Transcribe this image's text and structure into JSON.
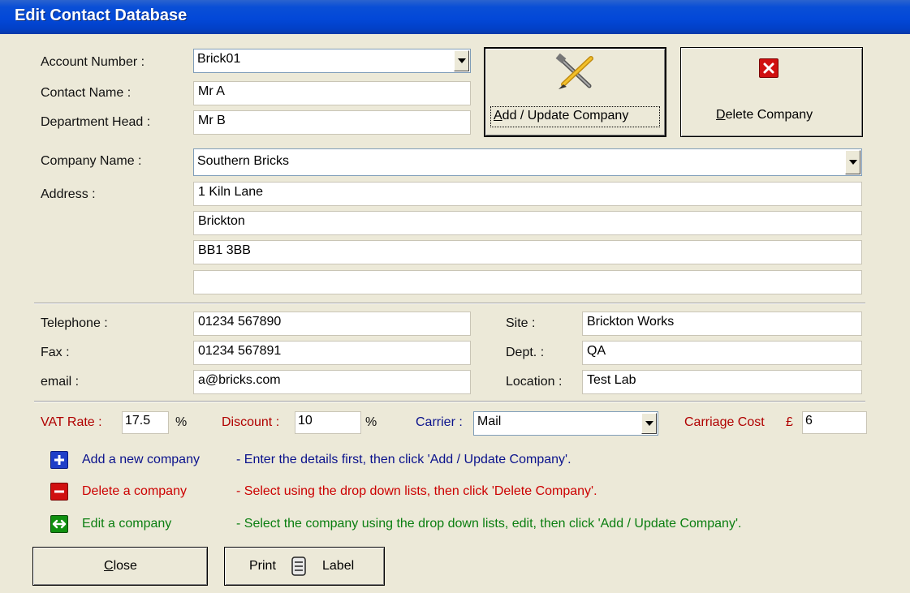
{
  "window": {
    "title": "Edit Contact Database"
  },
  "labels": {
    "account_number": "Account Number :",
    "contact_name": "Contact Name :",
    "department_head": "Department Head :",
    "company_name": "Company Name :",
    "address": "Address :",
    "telephone": "Telephone :",
    "fax": "Fax :",
    "email": "email :",
    "site": "Site :",
    "dept": "Dept. :",
    "location": "Location :",
    "vat_rate": "VAT Rate :",
    "vat_unit": "%",
    "discount": "Discount :",
    "discount_unit": "%",
    "carrier": "Carrier :",
    "carriage_cost": "Carriage Cost",
    "carriage_currency": "£"
  },
  "values": {
    "account_number": "Brick01",
    "contact_name": "Mr A",
    "department_head": "Mr B",
    "company_name": "Southern Bricks",
    "address_line1": "1 Kiln Lane",
    "address_line2": "Brickton",
    "address_line3": "BB1 3BB",
    "address_line4": "",
    "telephone": "01234 567890",
    "fax": "01234 567891",
    "email": "a@bricks.com",
    "site": "Brickton Works",
    "dept": "QA",
    "location": "Test Lab",
    "vat_rate": "17.5",
    "discount": "10",
    "carrier": "Mail",
    "carriage_cost": "6"
  },
  "buttons": {
    "add_update_pre": "",
    "add_update_key": "A",
    "add_update_rest": "dd / Update Company",
    "delete_key": "D",
    "delete_rest": "elete Company",
    "close_key": "C",
    "close_rest": "lose",
    "print_pre": "Print",
    "print_post": "Label"
  },
  "help": {
    "add_title": "Add a new company",
    "add_desc": "- Enter the details first, then click 'Add / Update Company'.",
    "delete_title": "Delete a company",
    "delete_desc": "- Select using the drop down lists, then click 'Delete Company'.",
    "edit_title": "Edit a company",
    "edit_desc": "- Select the company using the drop down lists, edit, then click 'Add / Update Company'."
  },
  "colors": {
    "titlebar": "#0348d8",
    "add_icon": "#1f3fc8",
    "delete_icon": "#d01010",
    "edit_icon": "#109010"
  }
}
